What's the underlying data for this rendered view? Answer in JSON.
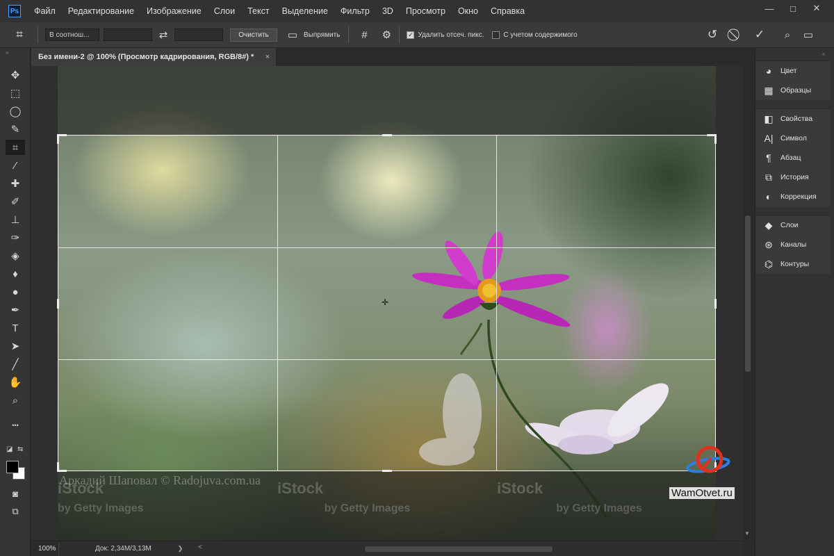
{
  "app": {
    "logo": "Ps"
  },
  "menu": [
    "Файл",
    "Редактирование",
    "Изображение",
    "Слои",
    "Текст",
    "Выделение",
    "Фильтр",
    "3D",
    "Просмотр",
    "Окно",
    "Справка"
  ],
  "window_controls": {
    "minimize": "—",
    "maximize": "□",
    "close": "✕"
  },
  "options_bar": {
    "ratio_value": "В соотнош...",
    "width_value": "",
    "height_value": "",
    "clear_label": "Очистить",
    "straighten_label": "Выпрямить",
    "delete_cropped_label": "Удалить отсеч. пикс.",
    "delete_cropped_checked": true,
    "content_aware_label": "С учетом содержимого",
    "content_aware_checked": false
  },
  "document": {
    "tab_title": "Без имени-2 @ 100% (Просмотр кадрирования, RGB/8#) *",
    "close": "×",
    "credit_text": "Аркадий Шаповал © Radojuva.com.ua",
    "watermark_logo": "iStock",
    "watermark_sub": "by Getty Images"
  },
  "overlay": {
    "site_name": "WamOtvet.ru"
  },
  "tools": [
    {
      "icon": "move-icon",
      "glyph": "✥"
    },
    {
      "icon": "marquee-icon",
      "glyph": "⬚"
    },
    {
      "icon": "lasso-icon",
      "glyph": "◯"
    },
    {
      "icon": "quick-select-icon",
      "glyph": "✎"
    },
    {
      "icon": "crop-icon",
      "glyph": "⌗"
    },
    {
      "icon": "eyedropper-icon",
      "glyph": "⁄"
    },
    {
      "icon": "healing-icon",
      "glyph": "✚"
    },
    {
      "icon": "brush-icon",
      "glyph": "✐"
    },
    {
      "icon": "stamp-icon",
      "glyph": "⊥"
    },
    {
      "icon": "history-brush-icon",
      "glyph": "✑"
    },
    {
      "icon": "eraser-icon",
      "glyph": "◈"
    },
    {
      "icon": "blur-icon",
      "glyph": "♦"
    },
    {
      "icon": "dodge-icon",
      "glyph": "●"
    },
    {
      "icon": "pen-icon",
      "glyph": "✒"
    },
    {
      "icon": "type-icon",
      "glyph": "T"
    },
    {
      "icon": "path-select-icon",
      "glyph": "➤"
    },
    {
      "icon": "line-icon",
      "glyph": "╱"
    },
    {
      "icon": "hand-icon",
      "glyph": "✋"
    },
    {
      "icon": "zoom-icon",
      "glyph": "⌕"
    },
    {
      "icon": "more-tools-icon",
      "glyph": "•••"
    }
  ],
  "panels": {
    "group1": [
      {
        "label": "Цвет",
        "icon": "color-icon",
        "glyph": "◕"
      },
      {
        "label": "Образцы",
        "icon": "swatches-icon",
        "glyph": "▦"
      }
    ],
    "group2": [
      {
        "label": "Свойства",
        "icon": "properties-icon",
        "glyph": "◧"
      },
      {
        "label": "Символ",
        "icon": "character-icon",
        "glyph": "A|"
      },
      {
        "label": "Абзац",
        "icon": "paragraph-icon",
        "glyph": "¶"
      },
      {
        "label": "История",
        "icon": "history-icon",
        "glyph": "⧉"
      },
      {
        "label": "Коррекция",
        "icon": "adjustments-icon",
        "glyph": "◐"
      }
    ],
    "group3": [
      {
        "label": "Слои",
        "icon": "layers-icon",
        "glyph": "◆"
      },
      {
        "label": "Каналы",
        "icon": "channels-icon",
        "glyph": "⊛"
      },
      {
        "label": "Контуры",
        "icon": "paths-icon",
        "glyph": "⌬"
      }
    ]
  },
  "status": {
    "zoom": "100%",
    "doc_info": "Док: 2,34M/3,13M",
    "arrow": "❯",
    "scroll_left": "<"
  },
  "colors": {
    "accent": "#4aa0ff",
    "crop_line": "#f2f2f2",
    "flower": "#d43bd1"
  }
}
